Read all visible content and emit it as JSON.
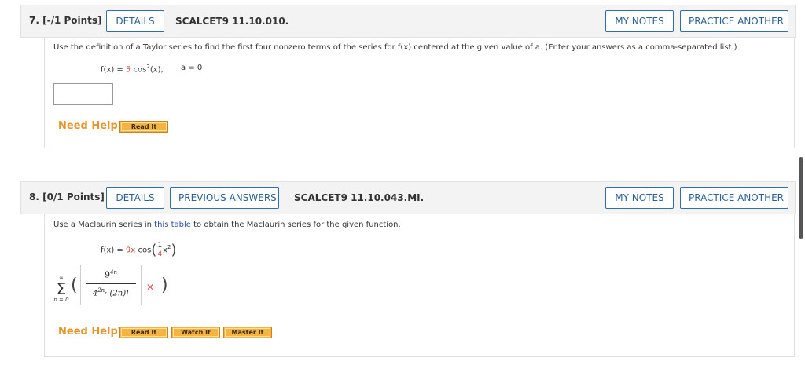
{
  "q7": {
    "number": "7.",
    "points": "[-/1 Points]",
    "details": "DETAILS",
    "code": "SCALCET9 11.10.010.",
    "my_notes": "MY NOTES",
    "practice": "PRACTICE ANOTHER",
    "prompt": "Use the definition of a Taylor series to find the first four nonzero terms of the series for f(x) centered at the given value of a. (Enter your answers as a comma-separated list.)",
    "fx_label": "f(x) =",
    "fx_coef": "5",
    "fx_func": "cos",
    "fx_exp": "2",
    "fx_arg": "(x),",
    "a_label": "a = 0",
    "answer_value": "",
    "need_help": "Need Help?",
    "read_it": "Read It"
  },
  "q8": {
    "number": "8.",
    "points": "[0/1 Points]",
    "details": "DETAILS",
    "previous": "PREVIOUS ANSWERS",
    "code": "SCALCET9 11.10.043.MI.",
    "my_notes": "MY NOTES",
    "practice": "PRACTICE ANOTHER",
    "prompt_before": "Use a Maclaurin series in",
    "prompt_link": "this table",
    "prompt_after": "to obtain the Maclaurin series for the given function.",
    "fx_label": "f(x) =",
    "fx_coef": "9x",
    "fx_func": "cos",
    "frac_num": "1",
    "frac_den": "4",
    "fx_var": "x",
    "fx_exp": "2",
    "sum_upper": "∞",
    "sum_symbol": "Σ",
    "sum_lower": "n = 0",
    "ans_num_base": "9",
    "ans_num_exp": "4n",
    "ans_den_base": "4",
    "ans_den_exp": "2n",
    "ans_den_rest": "· (2n)!",
    "wrong_mark": "✕",
    "need_help": "Need Help?",
    "read_it": "Read It",
    "watch_it": "Watch It",
    "master_it": "Master It"
  },
  "colors": {
    "accent": "#2f6ea8",
    "help": "#e6952b",
    "error": "#d9534f"
  }
}
